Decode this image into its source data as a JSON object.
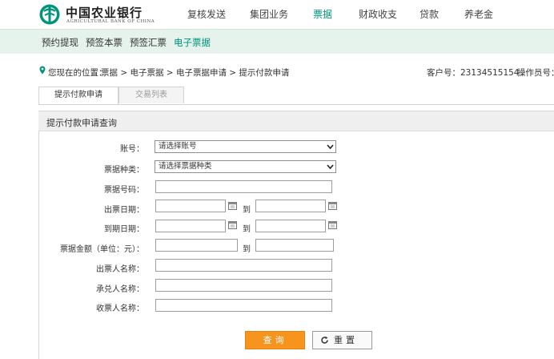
{
  "brand": {
    "name_cn": "中国农业银行",
    "name_en": "AGRICULTURAL BANK OF CHINA",
    "color": "#00947d"
  },
  "top_nav": [
    {
      "label": "复核发送",
      "active": false
    },
    {
      "label": "集团业务",
      "active": false
    },
    {
      "label": "票据",
      "active": true
    },
    {
      "label": "财政收支",
      "active": false
    },
    {
      "label": "贷款",
      "active": false
    },
    {
      "label": "养老金",
      "active": false
    }
  ],
  "sub_nav": [
    {
      "label": "预约提现",
      "active": false
    },
    {
      "label": "预签本票",
      "active": false
    },
    {
      "label": "预签汇票",
      "active": false
    },
    {
      "label": "电子票据",
      "active": true
    }
  ],
  "breadcrumb": {
    "prefix": "您现在的位置：",
    "path": "票据 > 电子票据 > 电子票据申请 > 提示付款申请",
    "customer_label": "客户号：23134515154",
    "operator_label": "操作员号："
  },
  "tabs": [
    {
      "label": "提示付款申请",
      "active": true
    },
    {
      "label": "交易列表",
      "active": false
    }
  ],
  "panel_title": "提示付款申请查询",
  "form": {
    "account_label": "账号：",
    "account_value": "请选择账号",
    "bill_type_label": "票据种类：",
    "bill_type_value": "请选择票据种类",
    "bill_no_label": "票据号码：",
    "issue_date_label": "出票日期：",
    "due_date_label": "到期日期：",
    "amount_label": "票据金额（单位：元）：",
    "drawer_label": "出票人名称：",
    "acceptor_label": "承兑人名称：",
    "payee_label": "收票人名称：",
    "to_label": "到"
  },
  "buttons": {
    "query": "查询",
    "reset": "重置"
  },
  "colors": {
    "accent": "#00947d",
    "subnav_bg": "#e5f3ec",
    "button_orange": "#f7941d"
  },
  "icons": {
    "logo": "abc-logo-icon",
    "location": "location-pin-icon",
    "calendar": "calendar-icon",
    "dropdown": "chevron-down-icon",
    "reset": "refresh-icon"
  }
}
